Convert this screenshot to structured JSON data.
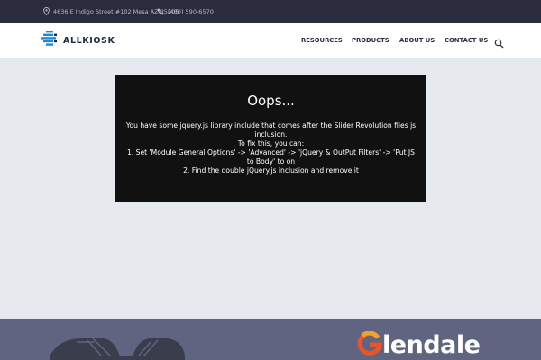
{
  "topbar": {
    "address": "4636 E Indigo Street #102 Mesa AZ 85205",
    "phone": "(480) 590-6570"
  },
  "header": {
    "logo_text": "ALLKIOSK",
    "nav": [
      "RESOURCES",
      "PRODUCTS",
      "ABOUT US",
      "CONTACT US"
    ]
  },
  "error": {
    "title": "Oops...",
    "lines": [
      "You have some jquery.js library include that comes after the Slider Revolution files js inclusion.",
      "To fix this, you can:",
      "1. Set 'Module General Options' -> 'Advanced' -> 'jQuery & OutPut Filters' -> 'Put JS to Body' to on",
      "2. Find the double jQuery.js inclusion and remove it"
    ]
  },
  "footer": {
    "partner_right_text": "lendale"
  },
  "colors": {
    "topbar_bg": "#2a2b3d",
    "page_bg": "#e6e9ed",
    "error_bg": "#111111",
    "footer_bg": "#5f6480",
    "logo_accent": "#1e88d9",
    "glendale_accent": "#e8552a"
  }
}
